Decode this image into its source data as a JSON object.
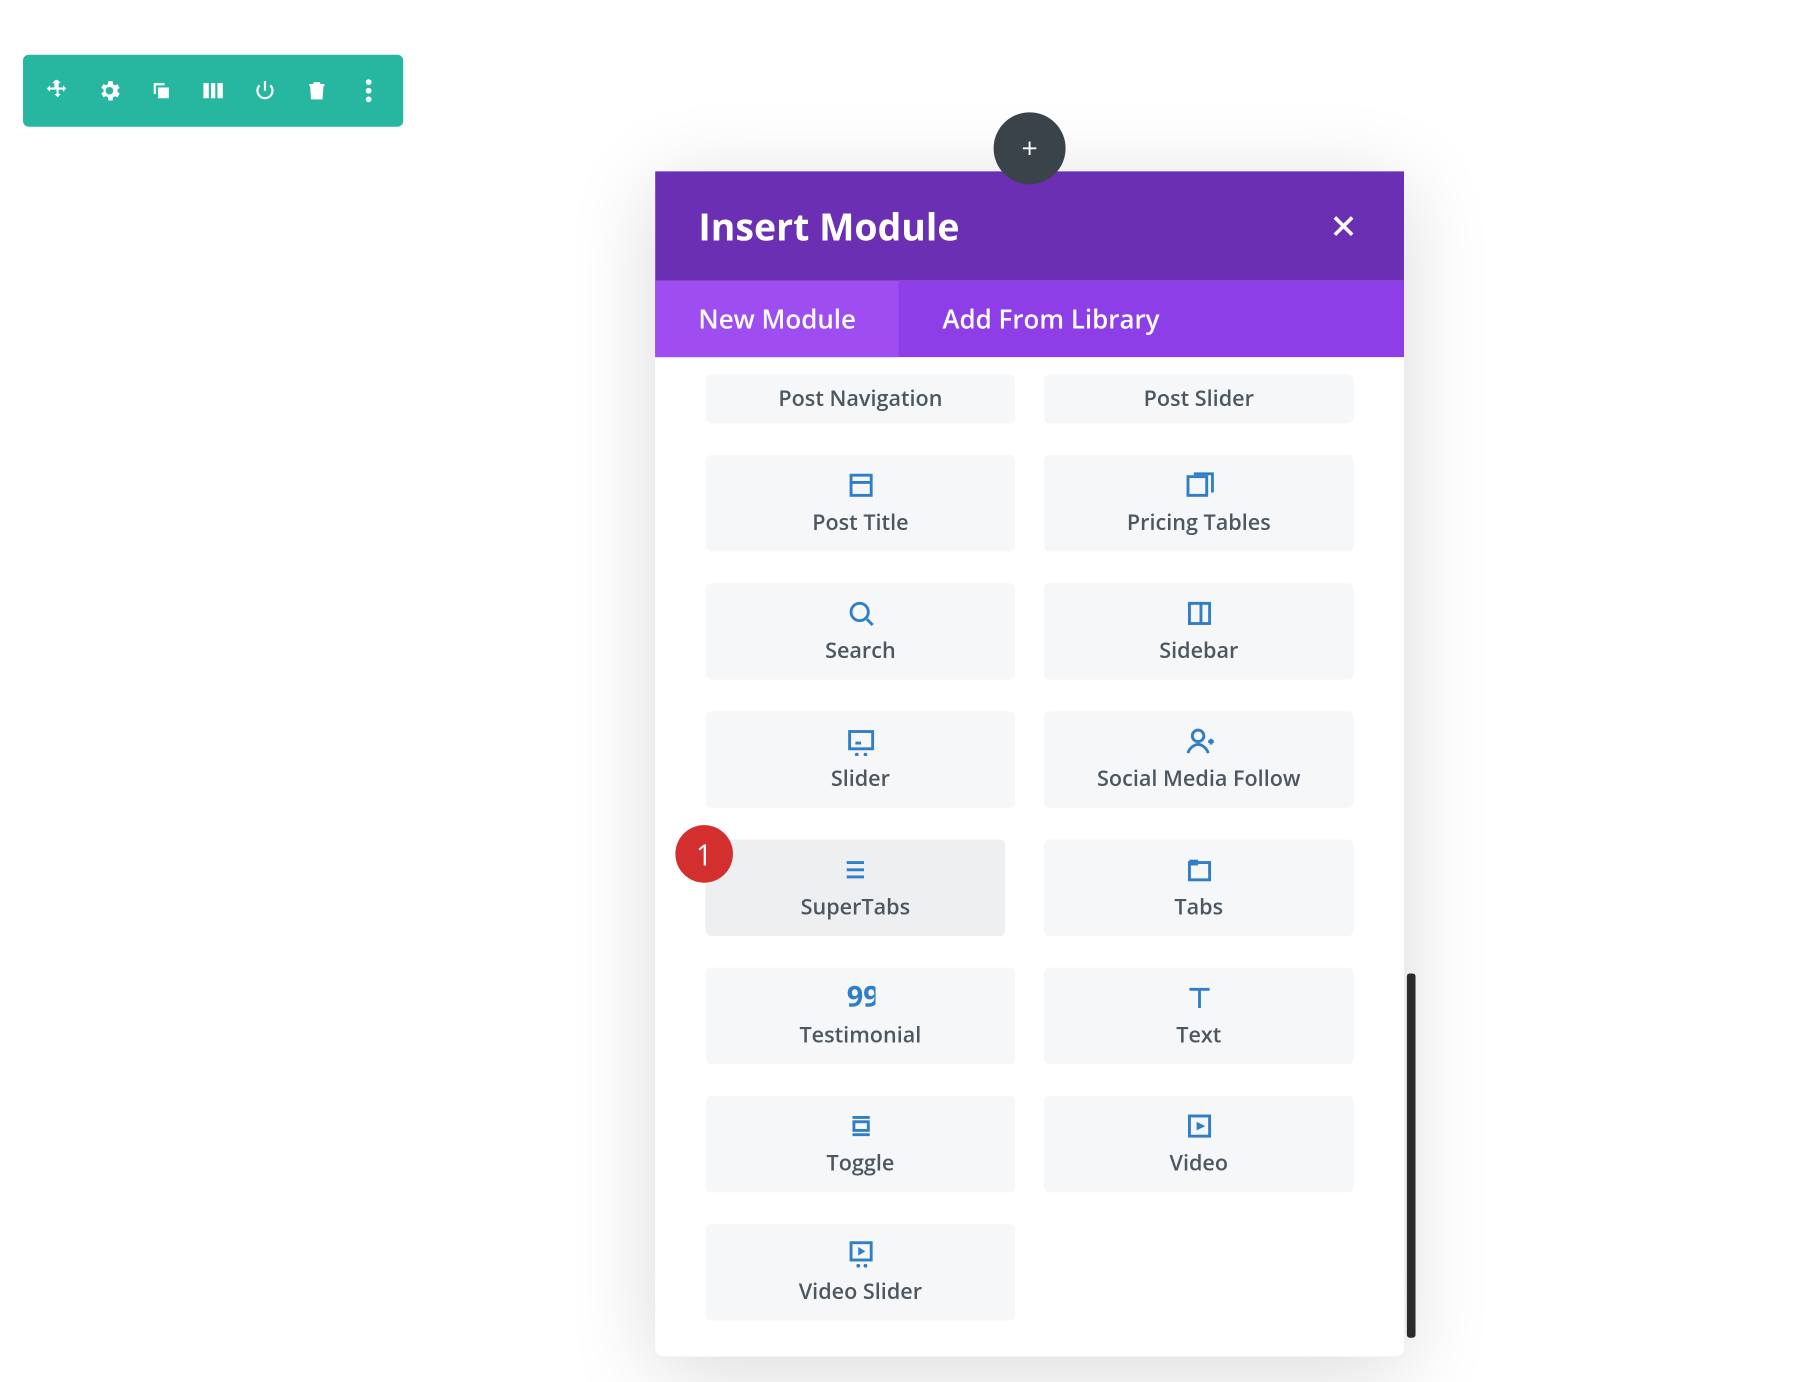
{
  "toolbar": {
    "icons": [
      "move",
      "gear",
      "duplicate",
      "columns",
      "power",
      "trash",
      "more"
    ]
  },
  "fab": {
    "name": "add-module"
  },
  "modal": {
    "title": "Insert Module",
    "tabs": [
      {
        "label": "New Module",
        "active": true
      },
      {
        "label": "Add From Library",
        "active": false
      }
    ],
    "modules": [
      {
        "label": "Post Navigation",
        "icon": "none",
        "first": true
      },
      {
        "label": "Post Slider",
        "icon": "none",
        "first": true
      },
      {
        "label": "Post Title",
        "icon": "window"
      },
      {
        "label": "Pricing Tables",
        "icon": "stack"
      },
      {
        "label": "Search",
        "icon": "search"
      },
      {
        "label": "Sidebar",
        "icon": "sidebar"
      },
      {
        "label": "Slider",
        "icon": "slider"
      },
      {
        "label": "Social Media Follow",
        "icon": "person-plus"
      },
      {
        "label": "SuperTabs",
        "icon": "lines",
        "highlight": true
      },
      {
        "label": "Tabs",
        "icon": "tab"
      },
      {
        "label": "Testimonial",
        "icon": "quote"
      },
      {
        "label": "Text",
        "icon": "text"
      },
      {
        "label": "Toggle",
        "icon": "toggle"
      },
      {
        "label": "Video",
        "icon": "play"
      },
      {
        "label": "Video Slider",
        "icon": "play-slider"
      }
    ]
  },
  "callout": {
    "number": "1"
  },
  "colors": {
    "teal": "#27b6a0",
    "purpleDark": "#6b2fb3",
    "purpleLight": "#8e3ee6",
    "iconBlue": "#2f7ec7",
    "itemText": "#4c5760",
    "badgeRed": "#d32f2f"
  }
}
